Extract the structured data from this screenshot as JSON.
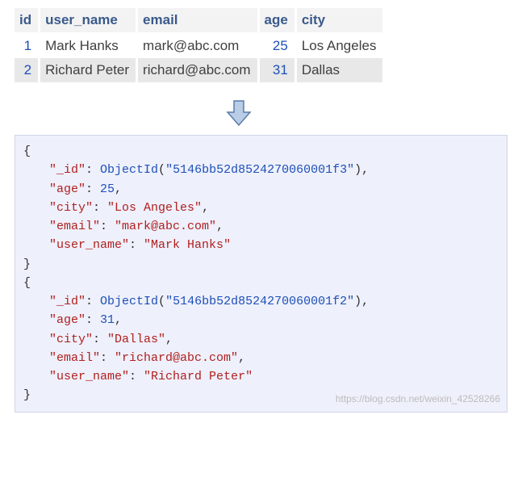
{
  "table": {
    "headers": [
      "id",
      "user_name",
      "email",
      "age",
      "city"
    ],
    "rows": [
      {
        "id": "1",
        "user_name": "Mark Hanks",
        "email": "mark@abc.com",
        "age": "25",
        "city": "Los Angeles"
      },
      {
        "id": "2",
        "user_name": "Richard Peter",
        "email": "richard@abc.com",
        "age": "31",
        "city": "Dallas"
      }
    ]
  },
  "arrow": {
    "fill": "#b9cde6",
    "stroke": "#5a7da8"
  },
  "json_docs": [
    {
      "_id": {
        "fn": "ObjectId",
        "arg": "\"5146bb52d8524270060001f3\""
      },
      "age": {
        "val": "25",
        "type": "num"
      },
      "city": {
        "val": "\"Los Angeles\"",
        "type": "str"
      },
      "email": {
        "val": "\"mark@abc.com\"",
        "type": "str"
      },
      "user_name": {
        "val": "\"Mark Hanks\"",
        "type": "str"
      }
    },
    {
      "_id": {
        "fn": "ObjectId",
        "arg": "\"5146bb52d8524270060001f2\""
      },
      "age": {
        "val": "31",
        "type": "num"
      },
      "city": {
        "val": "\"Dallas\"",
        "type": "str"
      },
      "email": {
        "val": "\"richard@abc.com\"",
        "type": "str"
      },
      "user_name": {
        "val": "\"Richard Peter\"",
        "type": "str"
      }
    }
  ],
  "watermark": "https://blog.csdn.net/weixin_42528266"
}
